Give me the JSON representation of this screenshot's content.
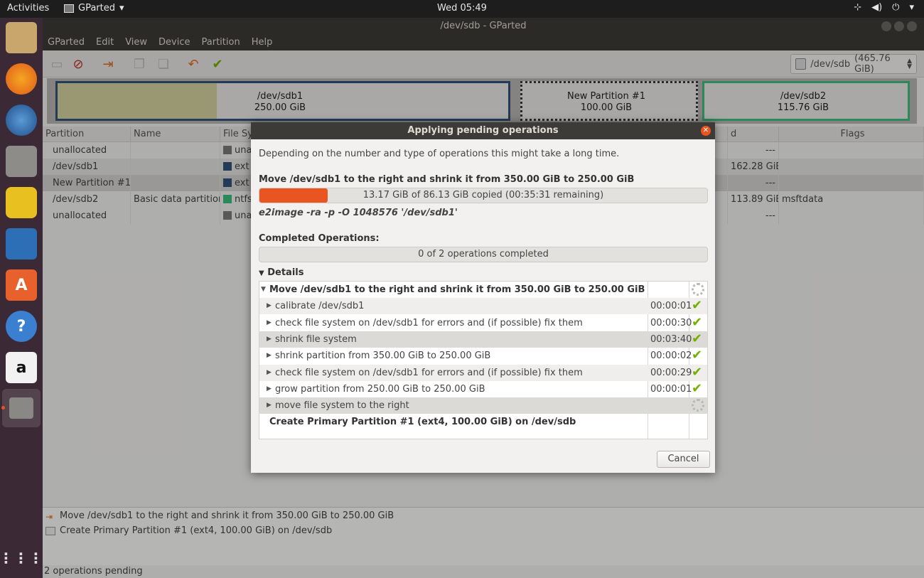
{
  "topbar": {
    "activities": "Activities",
    "app_name": "GParted",
    "app_caret": "▾",
    "clock": "Wed 05:49",
    "icons": [
      "network-icon",
      "volume-icon",
      "power-icon",
      "menu-caret-icon"
    ]
  },
  "window": {
    "title": "/dev/sdb - GParted"
  },
  "menu": [
    "GParted",
    "Edit",
    "View",
    "Device",
    "Partition",
    "Help"
  ],
  "device_selector": {
    "device": "/dev/sdb",
    "size": "(465.76 GiB)"
  },
  "partition_map": [
    {
      "name": "/dev/sdb1",
      "size": "250.00 GiB"
    },
    {
      "name": "New Partition #1",
      "size": "100.00 GiB"
    },
    {
      "name": "/dev/sdb2",
      "size": "115.76 GiB"
    }
  ],
  "table": {
    "headers": {
      "partition": "Partition",
      "name": "Name",
      "filesystem": "File Sy",
      "used": "d",
      "flags": "Flags"
    },
    "rows": [
      {
        "partition": "unallocated",
        "name": "",
        "fs": "una",
        "fs_color": "#7a7a7a",
        "used": "---",
        "flags": ""
      },
      {
        "partition": "/dev/sdb1",
        "name": "",
        "fs": "ext",
        "fs_color": "#33527a",
        "used": "162.28 GiB",
        "flags": ""
      },
      {
        "partition": "New Partition #1",
        "name": "",
        "fs": "ext",
        "fs_color": "#33527a",
        "used": "---",
        "flags": ""
      },
      {
        "partition": "/dev/sdb2",
        "name": "Basic data partition",
        "fs": "ntfs",
        "fs_color": "#3dbb7c",
        "used": "113.89 GiB",
        "flags": "msftdata"
      },
      {
        "partition": "unallocated",
        "name": "",
        "fs": "una",
        "fs_color": "#7a7a7a",
        "used": "---",
        "flags": ""
      }
    ]
  },
  "pending_ops": [
    "Move /dev/sdb1 to the right and shrink it from 350.00 GiB to 250.00 GiB",
    "Create Primary Partition #1 (ext4, 100.00 GiB) on /dev/sdb"
  ],
  "status": "2 operations pending",
  "dialog": {
    "title": "Applying pending operations",
    "intro": "Depending on the number and type of operations this might take a long time.",
    "current_op": "Move /dev/sdb1 to the right and shrink it from 350.00 GiB to 250.00 GiB",
    "progress_text": "13.17 GiB of 86.13 GiB copied (00:35:31 remaining)",
    "progress_fraction": 0.153,
    "command": "e2image -ra -p -O 1048576 '/dev/sdb1'",
    "completed_label": "Completed Operations:",
    "completed_text": "0 of 2 operations completed",
    "completed_fraction": 0,
    "details_label": "Details",
    "details": [
      {
        "label": "Move /dev/sdb1 to the right and shrink it from 350.00 GiB to 250.00 GiB",
        "time": "",
        "status": "running",
        "level": 0,
        "bold": true,
        "expander": "▼"
      },
      {
        "label": "calibrate /dev/sdb1",
        "time": "00:00:01",
        "status": "done",
        "level": 1,
        "bold": false,
        "expander": "▶"
      },
      {
        "label": "check file system on /dev/sdb1 for errors and (if possible) fix them",
        "time": "00:00:30",
        "status": "done",
        "level": 1,
        "bold": false,
        "expander": "▶"
      },
      {
        "label": "shrink file system",
        "time": "00:03:40",
        "status": "done",
        "level": 1,
        "bold": false,
        "expander": "▶"
      },
      {
        "label": "shrink partition from 350.00 GiB to 250.00 GiB",
        "time": "00:00:02",
        "status": "done",
        "level": 1,
        "bold": false,
        "expander": "▶"
      },
      {
        "label": "check file system on /dev/sdb1 for errors and (if possible) fix them",
        "time": "00:00:29",
        "status": "done",
        "level": 1,
        "bold": false,
        "expander": "▶"
      },
      {
        "label": "grow partition from 250.00 GiB to 250.00 GiB",
        "time": "00:00:01",
        "status": "done",
        "level": 1,
        "bold": false,
        "expander": "▶"
      },
      {
        "label": "move file system to the right",
        "time": "",
        "status": "running",
        "level": 1,
        "bold": false,
        "expander": "▶"
      },
      {
        "label": "Create Primary Partition #1 (ext4, 100.00 GiB) on /dev/sdb",
        "time": "",
        "status": "",
        "level": 0,
        "bold": true,
        "expander": ""
      }
    ],
    "cancel": "Cancel"
  },
  "colors": {
    "accent": "#e95420",
    "check": "#73b000",
    "sdb1_border": "#33527a",
    "sdb2_border": "#3dbb7c",
    "used_fill": "#d6d2a0"
  }
}
